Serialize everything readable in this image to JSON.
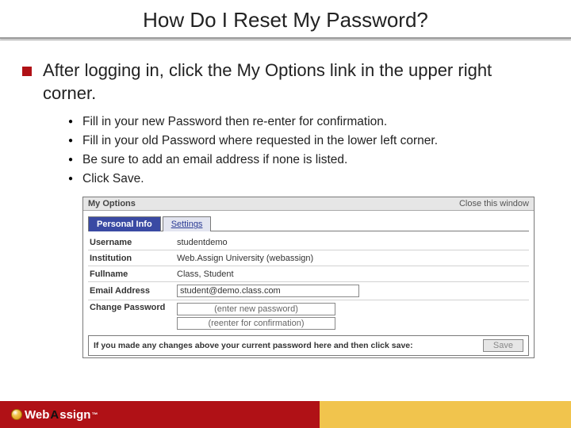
{
  "title": "How Do I Reset My Password?",
  "main_bullet": "After logging in, click the My Options link in the upper right corner.",
  "sub_bullets": [
    "Fill in your new Password then re-enter for confirmation.",
    "Fill in your old Password where requested in the lower left corner.",
    "Be sure to add an email address if none is listed.",
    "Click Save."
  ],
  "dialog": {
    "title": "My Options",
    "close": "Close this window",
    "tabs": {
      "active": "Personal Info",
      "inactive": "Settings"
    },
    "rows": {
      "username_label": "Username",
      "username_value": "studentdemo",
      "institution_label": "Institution",
      "institution_value": "Web.Assign University (webassign)",
      "fullname_label": "Fullname",
      "fullname_value": "Class, Student",
      "email_label": "Email Address",
      "email_value": "student@demo.class.com",
      "changepw_label": "Change Password",
      "pw1_placeholder": "(enter new password)",
      "pw2_placeholder": "(reenter for confirmation)"
    },
    "save_note": "If you made any changes above your current password here and then click save:",
    "save_btn": "Save"
  },
  "logo": {
    "web": "Web",
    "assign": "ssign",
    "tm": "™"
  }
}
